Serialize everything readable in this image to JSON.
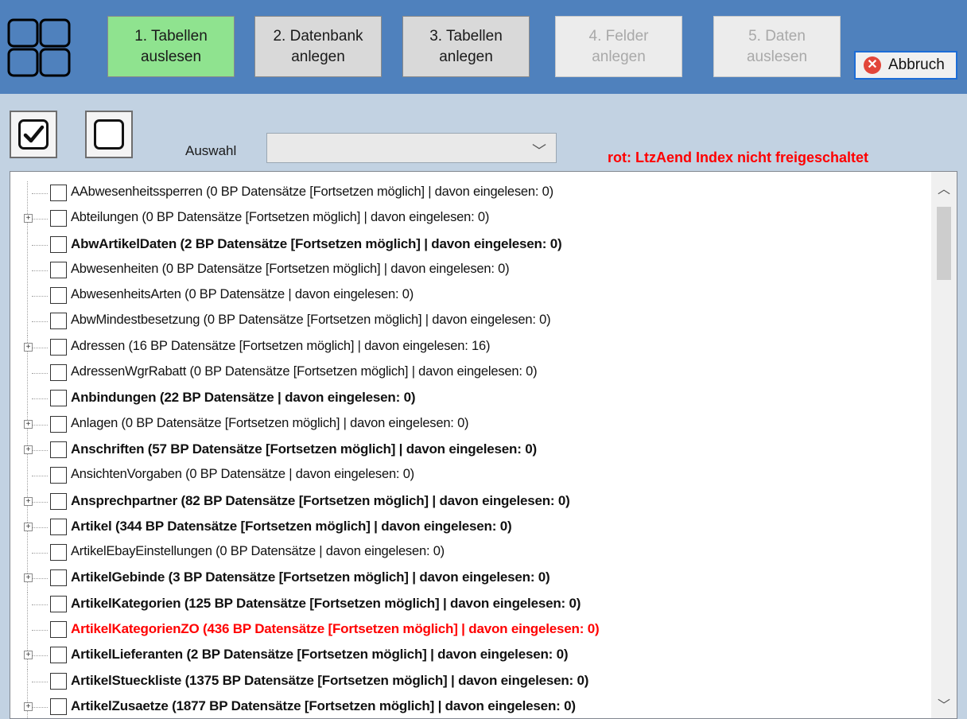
{
  "steps": [
    {
      "line1": "1. Tabellen",
      "line2": "auslesen",
      "state": "active"
    },
    {
      "line1": "2. Datenbank",
      "line2": "anlegen",
      "state": "normal"
    },
    {
      "line1": "3. Tabellen",
      "line2": "anlegen",
      "state": "normal"
    },
    {
      "line1": "4. Felder",
      "line2": "anlegen",
      "state": "disabled"
    },
    {
      "line1": "5. Daten",
      "line2": "auslesen",
      "state": "disabled"
    }
  ],
  "abbruch_label": "Abbruch",
  "auswahl_label": "Auswahl",
  "auswahl_value": "",
  "hint": "rot: LtzAend Index nicht freigeschaltet",
  "select_all_state": "checked",
  "select_none_state": "unchecked",
  "colors": {
    "header": "#4f81bd",
    "content": "#c2d2e2",
    "active_step": "#8fe38f",
    "hint": "#ff0000",
    "abbruch_border": "#1c6cd6"
  },
  "tree": [
    {
      "text": "AAbwesenheitssperren (0 BP Datensätze  [Fortsetzen möglich]  | davon eingelesen: 0)",
      "expandable": false,
      "bold": false,
      "red": false,
      "checked": false
    },
    {
      "text": "Abteilungen (0 BP Datensätze  [Fortsetzen möglich]  | davon eingelesen: 0)",
      "expandable": true,
      "bold": false,
      "red": false,
      "checked": false
    },
    {
      "text": "AbwArtikelDaten (2 BP Datensätze  [Fortsetzen möglich]  | davon eingelesen: 0)",
      "expandable": false,
      "bold": true,
      "red": false,
      "checked": false
    },
    {
      "text": "Abwesenheiten (0 BP Datensätze  [Fortsetzen möglich]  | davon eingelesen: 0)",
      "expandable": false,
      "bold": false,
      "red": false,
      "checked": false
    },
    {
      "text": "AbwesenheitsArten (0 BP Datensätze  | davon eingelesen: 0)",
      "expandable": false,
      "bold": false,
      "red": false,
      "checked": false
    },
    {
      "text": "AbwMindestbesetzung (0 BP Datensätze  [Fortsetzen möglich]  | davon eingelesen: 0)",
      "expandable": false,
      "bold": false,
      "red": false,
      "checked": false
    },
    {
      "text": "Adressen (16 BP Datensätze  [Fortsetzen möglich]  | davon eingelesen: 16)",
      "expandable": true,
      "bold": false,
      "red": false,
      "checked": false
    },
    {
      "text": "AdressenWgrRabatt (0 BP Datensätze  [Fortsetzen möglich]  | davon eingelesen: 0)",
      "expandable": false,
      "bold": false,
      "red": false,
      "checked": false
    },
    {
      "text": "Anbindungen (22 BP Datensätze  | davon eingelesen: 0)",
      "expandable": false,
      "bold": true,
      "red": false,
      "checked": false
    },
    {
      "text": "Anlagen (0 BP Datensätze  [Fortsetzen möglich]  | davon eingelesen: 0)",
      "expandable": true,
      "bold": false,
      "red": false,
      "checked": false
    },
    {
      "text": "Anschriften (57 BP Datensätze  [Fortsetzen möglich]  | davon eingelesen: 0)",
      "expandable": true,
      "bold": true,
      "red": false,
      "checked": false
    },
    {
      "text": "AnsichtenVorgaben (0 BP Datensätze  | davon eingelesen: 0)",
      "expandable": false,
      "bold": false,
      "red": false,
      "checked": false
    },
    {
      "text": "Ansprechpartner (82 BP Datensätze  [Fortsetzen möglich]  | davon eingelesen: 0)",
      "expandable": true,
      "bold": true,
      "red": false,
      "checked": false
    },
    {
      "text": "Artikel (344 BP Datensätze  [Fortsetzen möglich]  | davon eingelesen: 0)",
      "expandable": true,
      "bold": true,
      "red": false,
      "checked": false
    },
    {
      "text": "ArtikelEbayEinstellungen (0 BP Datensätze  | davon eingelesen: 0)",
      "expandable": false,
      "bold": false,
      "red": false,
      "checked": false
    },
    {
      "text": "ArtikelGebinde (3 BP Datensätze  [Fortsetzen möglich]  | davon eingelesen: 0)",
      "expandable": true,
      "bold": true,
      "red": false,
      "checked": false
    },
    {
      "text": "ArtikelKategorien (125 BP Datensätze  [Fortsetzen möglich]  | davon eingelesen: 0)",
      "expandable": false,
      "bold": true,
      "red": false,
      "checked": false
    },
    {
      "text": "ArtikelKategorienZO (436 BP Datensätze  [Fortsetzen möglich]  | davon eingelesen: 0)",
      "expandable": false,
      "bold": true,
      "red": true,
      "checked": false
    },
    {
      "text": "ArtikelLieferanten (2 BP Datensätze  [Fortsetzen möglich]  | davon eingelesen: 0)",
      "expandable": true,
      "bold": true,
      "red": false,
      "checked": false
    },
    {
      "text": "ArtikelStueckliste (1375 BP Datensätze  [Fortsetzen möglich]  | davon eingelesen: 0)",
      "expandable": false,
      "bold": true,
      "red": false,
      "checked": false
    },
    {
      "text": "ArtikelZusaetze (1877 BP Datensätze  [Fortsetzen möglich]  | davon eingelesen: 0)",
      "expandable": true,
      "bold": true,
      "red": false,
      "checked": false
    }
  ]
}
